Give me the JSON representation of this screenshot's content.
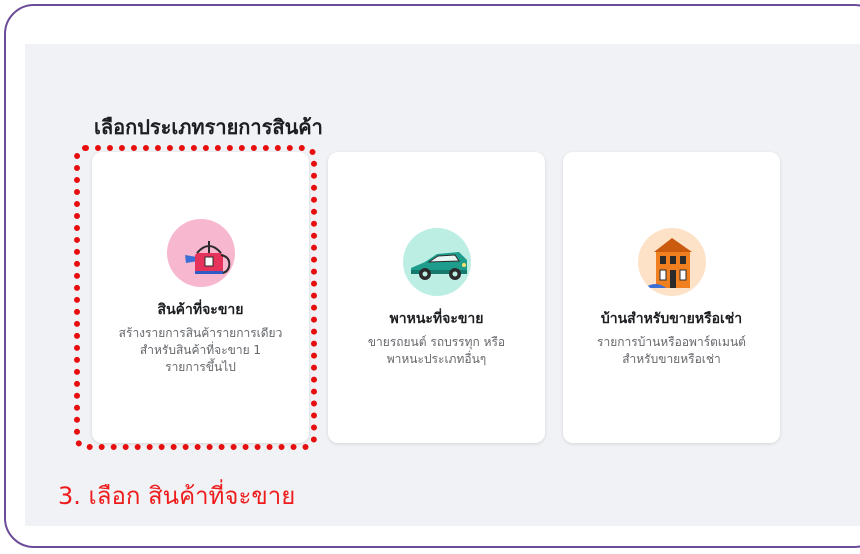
{
  "header": {
    "title": "เลือกประเภทรายการสินค้า"
  },
  "cards": [
    {
      "icon": "watering-can-icon",
      "title": "สินค้าที่จะขาย",
      "description": "สร้างรายการสินค้ารายการเดียว\nสำหรับสินค้าที่จะขาย 1\nรายการขึ้นไป"
    },
    {
      "icon": "car-icon",
      "title": "พาหนะที่จะขาย",
      "description": "ขายรถยนต์ รถบรรทุก หรือ\nพาหนะประเภทอื่นๆ"
    },
    {
      "icon": "house-icon",
      "title": "บ้านสำหรับขายหรือเช่า",
      "description": "รายการบ้านหรืออพาร์ตเมนต์\nสำหรับขายหรือเช่า"
    }
  ],
  "annotation": {
    "text": "3. เลือก สินค้าที่จะขาย",
    "color": "#ee1c1c"
  },
  "colors": {
    "frame_border": "#6b4c9a",
    "panel_background": "#f0f2f5",
    "highlight_dots": "#e60e0e"
  }
}
